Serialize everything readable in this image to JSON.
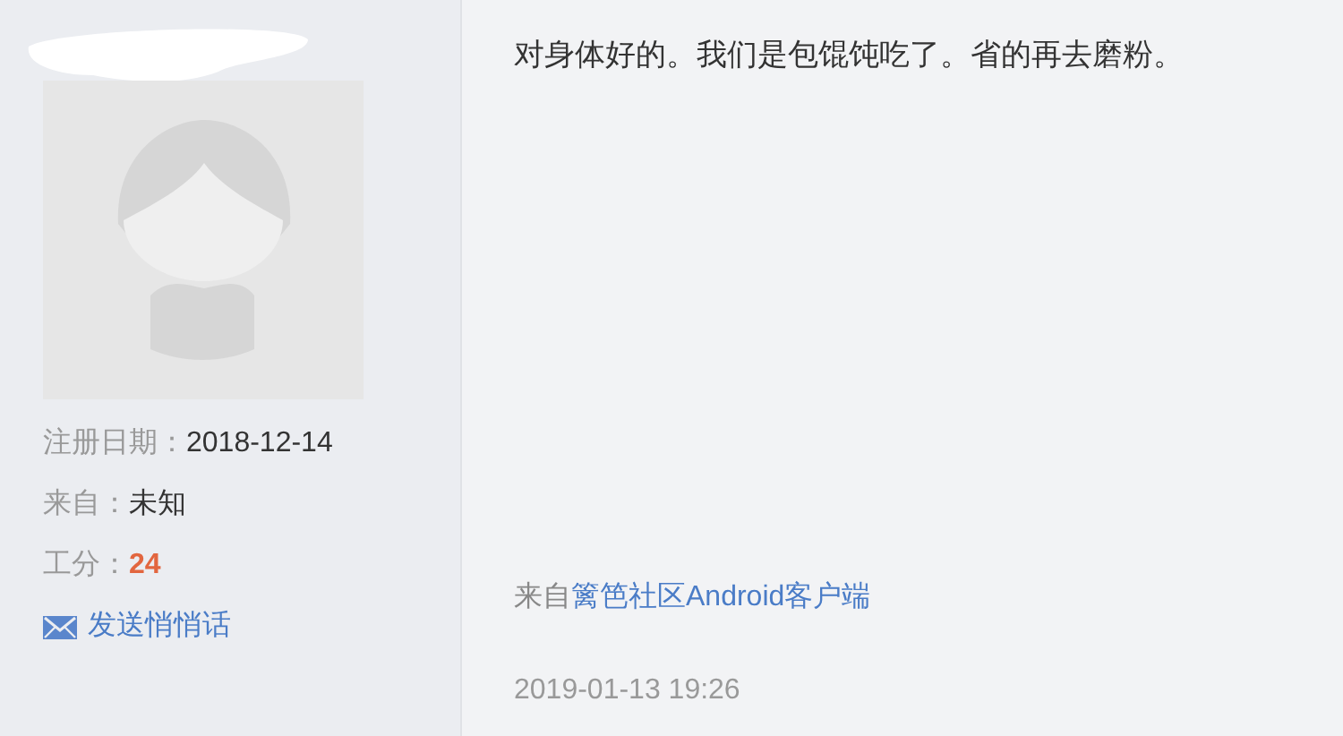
{
  "profile": {
    "fields": [
      {
        "label": "注册日期：",
        "value": "2018-12-14",
        "kind": "plain"
      },
      {
        "label": "来自：",
        "value": "未知",
        "kind": "plain"
      },
      {
        "label": "工分：",
        "value": "24",
        "kind": "score"
      }
    ],
    "message_link": "发送悄悄话"
  },
  "post": {
    "body": "对身体好的。我们是包馄饨吃了。省的再去磨粉。",
    "source_prefix": "来自",
    "source_link": "篱笆社区Android客户端",
    "time": "2019-01-13 19:26"
  }
}
